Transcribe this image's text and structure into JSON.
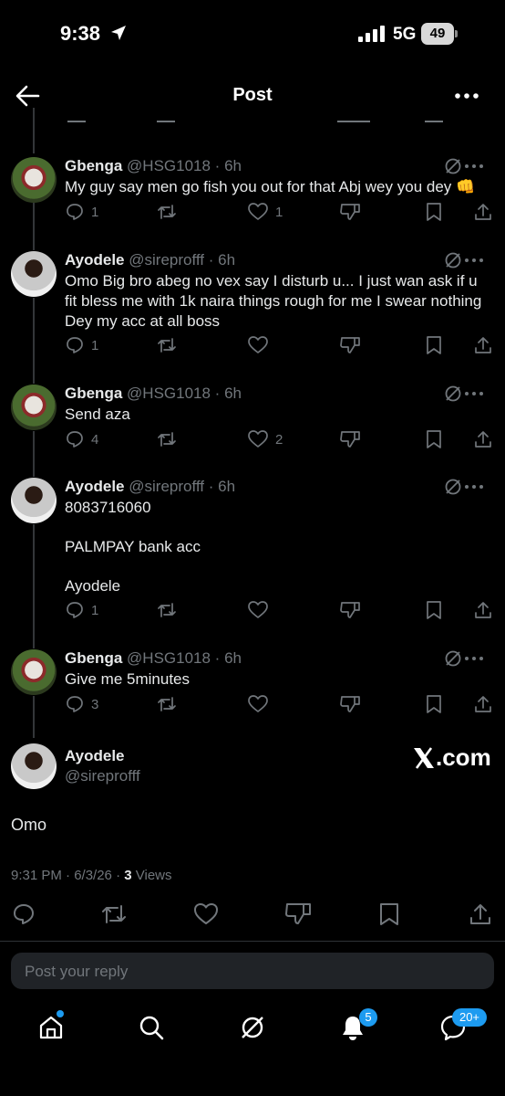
{
  "status_bar": {
    "time": "9:38",
    "network": "5G",
    "battery": "49"
  },
  "header": {
    "title": "Post"
  },
  "replies": [
    {
      "name": "Gbenga",
      "handle": "@HSG1018",
      "age": "6h",
      "text": "My guy say men go fish you out for that Abj wey you dey 👊",
      "counts": {
        "reply": "1",
        "repost": "",
        "like": "1"
      }
    },
    {
      "name": "Ayodele",
      "handle": "@sireprofff",
      "age": "6h",
      "text": "Omo Big bro abeg no vex say I disturb u... I just wan ask if u fit bless me with 1k naira things rough for me I swear nothing Dey my acc at all boss",
      "counts": {
        "reply": "1",
        "repost": "",
        "like": ""
      }
    },
    {
      "name": "Gbenga",
      "handle": "@HSG1018",
      "age": "6h",
      "text": "Send aza",
      "counts": {
        "reply": "4",
        "repost": "",
        "like": "2"
      }
    },
    {
      "name": "Ayodele",
      "handle": "@sireprofff",
      "age": "6h",
      "lines": [
        "8083716060",
        "PALMPAY bank acc",
        "Ayodele"
      ],
      "counts": {
        "reply": "1",
        "repost": "",
        "like": ""
      }
    },
    {
      "name": "Gbenga",
      "handle": "@HSG1018",
      "age": "6h",
      "text": "Give me 5minutes",
      "counts": {
        "reply": "3",
        "repost": "",
        "like": ""
      }
    }
  ],
  "main_post": {
    "name": "Ayodele",
    "handle": "@sireprofff",
    "watermark": ".com",
    "text": "Omo",
    "timestamp": "9:31 PM · 6/3/26 · ",
    "views_count": "3",
    "views_label": "Views"
  },
  "reply_box": {
    "placeholder": "Post your reply"
  },
  "tab_bar": {
    "notifications_badge": "5",
    "messages_badge": "20+"
  },
  "colors": {
    "background": "#000000",
    "text": "#e7e9ea",
    "secondary": "#71767b",
    "accent": "#1d9bf0"
  }
}
